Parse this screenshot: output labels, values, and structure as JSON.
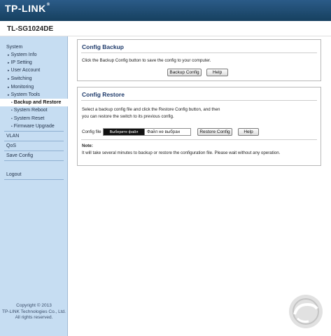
{
  "header": {
    "brand": "TP-LINK",
    "brand_mark": "®",
    "model": "TL-SG1024DE"
  },
  "sidebar": {
    "items": [
      {
        "label": "System",
        "level": "top"
      },
      {
        "label": "System Info",
        "level": "sub",
        "icon": "triangle-right-icon"
      },
      {
        "label": "IP Setting",
        "level": "sub",
        "icon": "triangle-right-icon"
      },
      {
        "label": "User Account",
        "level": "sub",
        "icon": "triangle-right-icon"
      },
      {
        "label": "Switching",
        "level": "sub",
        "icon": "triangle-right-icon"
      },
      {
        "label": "Monitoring",
        "level": "sub",
        "icon": "triangle-right-icon"
      },
      {
        "label": "System Tools",
        "level": "sub",
        "icon": "triangle-down-icon"
      },
      {
        "label": "Backup and Restore",
        "level": "subsub",
        "active": true
      },
      {
        "label": "System Reboot",
        "level": "subsub"
      },
      {
        "label": "System Reset",
        "level": "subsub"
      },
      {
        "label": "Firmware Upgrade",
        "level": "subsub"
      },
      {
        "label": "VLAN",
        "level": "top"
      },
      {
        "label": "QoS",
        "level": "top"
      },
      {
        "label": "Save Config",
        "level": "top"
      },
      {
        "label": "Logout",
        "level": "top"
      }
    ],
    "copyright_line1": "Copyright © 2013",
    "copyright_line2": "TP-LINK Technologies Co., Ltd.",
    "copyright_line3": "All rights reserved."
  },
  "backup": {
    "title": "Config Backup",
    "description": "Click the Backup Config button to save the config to your computer.",
    "backup_button": "Backup Config",
    "help_button": "Help"
  },
  "restore": {
    "title": "Config Restore",
    "description_line1": "Select a backup config file and click the Restore Config button, and then",
    "description_line2": "you can restore the switch to its previous config.",
    "file_label": "Config file",
    "choose_file_button": "Выберите файл",
    "file_status": "Файл не выбран",
    "restore_button": "Restore Config",
    "help_button": "Help",
    "note_title": "Note:",
    "note_text": "It will take several minutes to backup or restore the configuration file. Please wait without any operation."
  },
  "colors": {
    "header": "#1f4a70",
    "sidebar": "#c6ddf2",
    "panel_title": "#1f3b6b"
  }
}
